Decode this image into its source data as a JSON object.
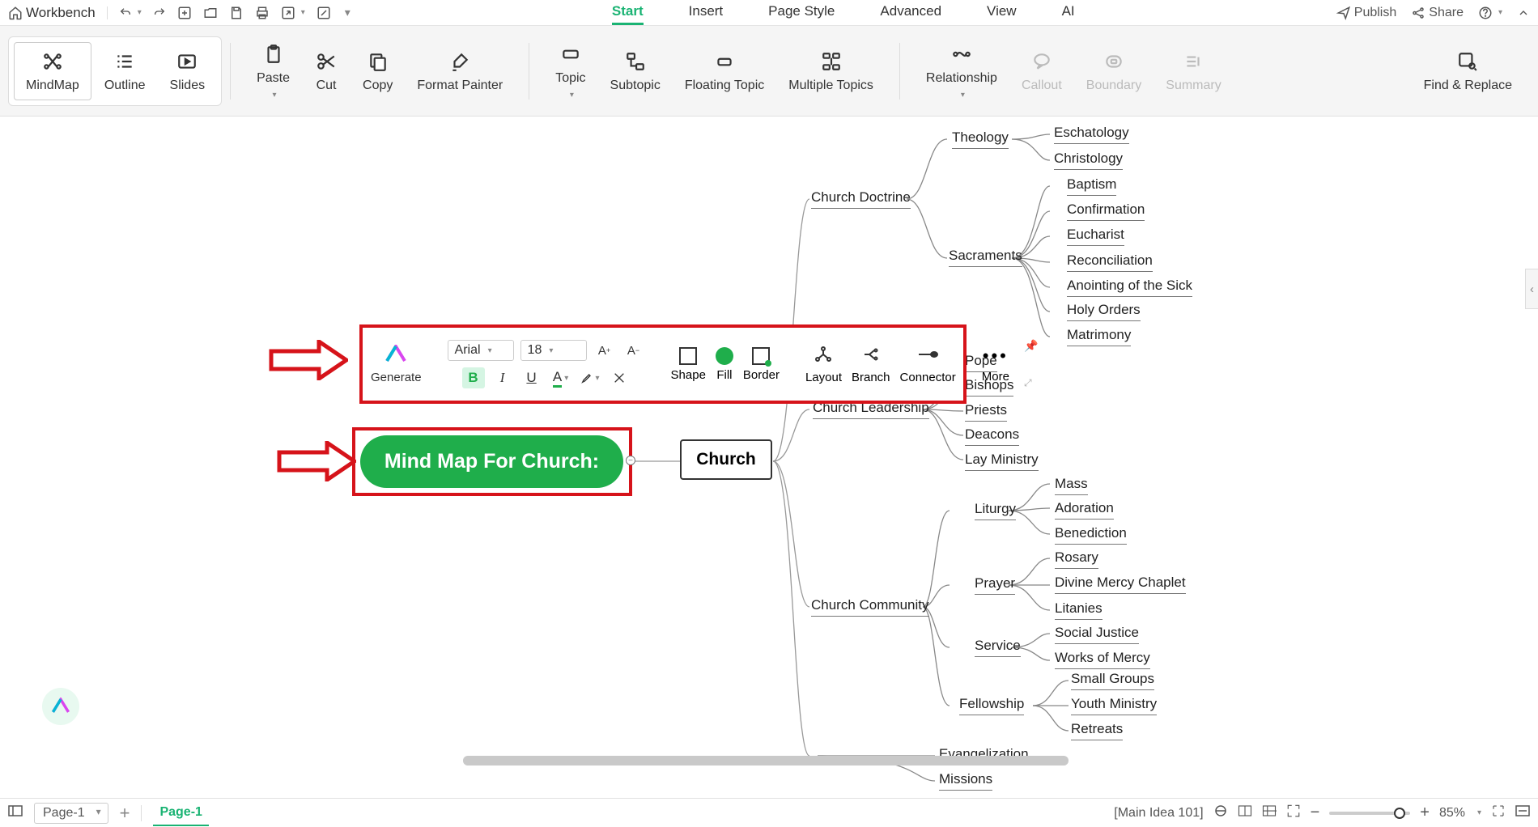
{
  "qa": {
    "workbench": "Workbench"
  },
  "menu": {
    "start": "Start",
    "insert": "Insert",
    "pageStyle": "Page Style",
    "advanced": "Advanced",
    "view": "View",
    "ai": "AI"
  },
  "top_right": {
    "publish": "Publish",
    "share": "Share"
  },
  "ribbon": {
    "mindmap": "MindMap",
    "outline": "Outline",
    "slides": "Slides",
    "paste": "Paste",
    "cut": "Cut",
    "copy": "Copy",
    "formatPainter": "Format Painter",
    "topic": "Topic",
    "subtopic": "Subtopic",
    "floatingTopic": "Floating Topic",
    "multipleTopics": "Multiple Topics",
    "relationship": "Relationship",
    "callout": "Callout",
    "boundary": "Boundary",
    "summary": "Summary",
    "findReplace": "Find & Replace"
  },
  "central": "Mind Map For Church:",
  "main": "Church",
  "subs": {
    "churchDoctrine": "Church Doctrine",
    "theology": "Theology",
    "sacraments": "Sacraments",
    "churchLeadership": "Church Leadership",
    "churchCommunity": "Church Community",
    "liturgy": "Liturgy",
    "prayer": "Prayer",
    "service": "Service",
    "fellowship": "Fellowship",
    "evangelization": "Evangelization",
    "missions": "Missions"
  },
  "leaves": {
    "eschatology": "Eschatology",
    "christology": "Christology",
    "baptism": "Baptism",
    "confirmation": "Confirmation",
    "eucharist": "Eucharist",
    "reconciliation": "Reconciliation",
    "anointing": "Anointing of the Sick",
    "holyOrders": "Holy Orders",
    "matrimony": "Matrimony",
    "pope": "Pope",
    "bishops": "Bishops",
    "priests": "Priests",
    "deacons": "Deacons",
    "layMinistry": "Lay Ministry",
    "mass": "Mass",
    "adoration": "Adoration",
    "benediction": "Benediction",
    "rosary": "Rosary",
    "divineMercy": "Divine Mercy Chaplet",
    "litanies": "Litanies",
    "socialJustice": "Social Justice",
    "worksOfMercy": "Works of Mercy",
    "smallGroups": "Small Groups",
    "youthMinistry": "Youth Ministry",
    "retreats": "Retreats"
  },
  "float_toolbar": {
    "generate": "Generate",
    "font": "Arial",
    "size": "18",
    "bold": "B",
    "italic": "I",
    "underline": "U",
    "fontColor": "A",
    "shape": "Shape",
    "fill": "Fill",
    "border": "Border",
    "layout": "Layout",
    "branch": "Branch",
    "connector": "Connector",
    "more": "More"
  },
  "status": {
    "page_selector": "Page-1",
    "page_tab": "Page-1",
    "node_info": "[Main Idea 101]",
    "zoom": "85%"
  }
}
